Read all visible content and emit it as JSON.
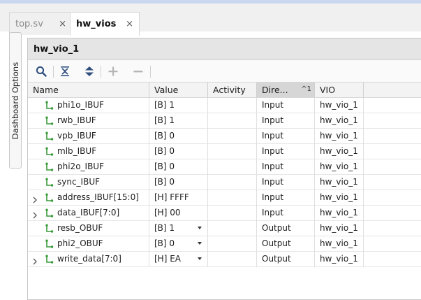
{
  "tabs": [
    {
      "label": "top.sv",
      "close": "×",
      "active": false
    },
    {
      "label": "hw_vios",
      "close": "×",
      "active": true
    }
  ],
  "side_tab": {
    "label": "Dashboard Options"
  },
  "panel": {
    "title": "hw_vio_1"
  },
  "toolbar": {
    "icons": [
      "search-icon",
      "collapse-all-icon",
      "expand-all-icon",
      "add-icon",
      "remove-icon"
    ]
  },
  "table": {
    "columns": [
      "Name",
      "Value",
      "Activity",
      "Dire...",
      "VIO"
    ],
    "sort_indicator": "^1",
    "rows": [
      {
        "name": "phi1o_IBUF",
        "value": "[B] 1",
        "activity": "",
        "direction": "Input",
        "vio": "hw_vio_1",
        "expandable": false,
        "dropdown": false
      },
      {
        "name": "rwb_IBUF",
        "value": "[B] 1",
        "activity": "",
        "direction": "Input",
        "vio": "hw_vio_1",
        "expandable": false,
        "dropdown": false
      },
      {
        "name": "vpb_IBUF",
        "value": "[B] 0",
        "activity": "",
        "direction": "Input",
        "vio": "hw_vio_1",
        "expandable": false,
        "dropdown": false
      },
      {
        "name": "mlb_IBUF",
        "value": "[B] 0",
        "activity": "",
        "direction": "Input",
        "vio": "hw_vio_1",
        "expandable": false,
        "dropdown": false
      },
      {
        "name": "phi2o_IBUF",
        "value": "[B] 0",
        "activity": "",
        "direction": "Input",
        "vio": "hw_vio_1",
        "expandable": false,
        "dropdown": false
      },
      {
        "name": "sync_IBUF",
        "value": "[B] 0",
        "activity": "",
        "direction": "Input",
        "vio": "hw_vio_1",
        "expandable": false,
        "dropdown": false
      },
      {
        "name": "address_IBUF[15:0]",
        "value": "[H] FFFF",
        "activity": "",
        "direction": "Input",
        "vio": "hw_vio_1",
        "expandable": true,
        "dropdown": false
      },
      {
        "name": "data_IBUF[7:0]",
        "value": "[H] 00",
        "activity": "",
        "direction": "Input",
        "vio": "hw_vio_1",
        "expandable": true,
        "dropdown": false
      },
      {
        "name": "resb_OBUF",
        "value": "[B] 1",
        "activity": "",
        "direction": "Output",
        "vio": "hw_vio_1",
        "expandable": false,
        "dropdown": true
      },
      {
        "name": "phi2_OBUF",
        "value": "[B] 0",
        "activity": "",
        "direction": "Output",
        "vio": "hw_vio_1",
        "expandable": false,
        "dropdown": true
      },
      {
        "name": "write_data[7:0]",
        "value": "[H] EA",
        "activity": "",
        "direction": "Output",
        "vio": "hw_vio_1",
        "expandable": true,
        "dropdown": true
      }
    ]
  },
  "colors": {
    "signal_icon": "#3a9a3a",
    "toolbar_icon": "#2f4f7f",
    "disabled_icon": "#b5b5b5"
  }
}
